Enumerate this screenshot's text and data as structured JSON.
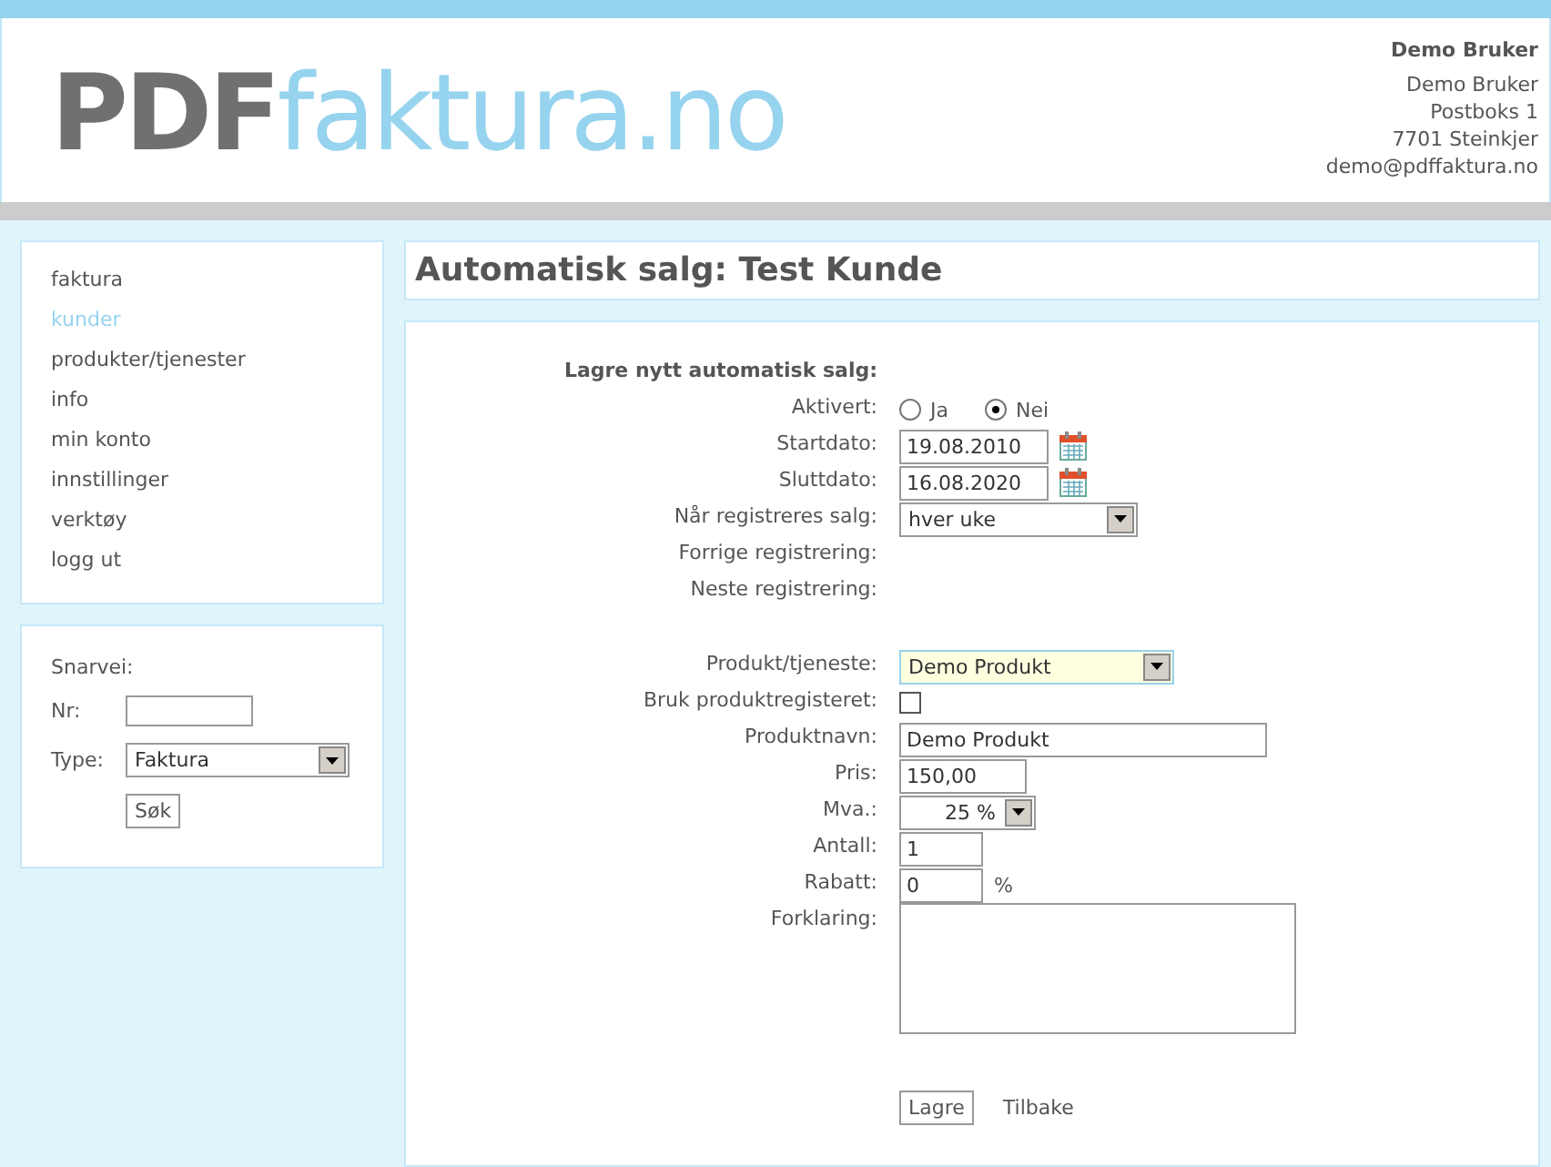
{
  "header": {
    "logo_dark": "PDF",
    "logo_light": "faktura.no",
    "user": {
      "name": "Demo Bruker",
      "lines": [
        "Demo Bruker",
        "Postboks 1",
        "7701 Steinkjer",
        "demo@pdffaktura.no"
      ]
    }
  },
  "nav": [
    {
      "label": "faktura",
      "selected": false
    },
    {
      "label": "kunder",
      "selected": true
    },
    {
      "label": "produkter/tjenester",
      "selected": false
    },
    {
      "label": "info",
      "selected": false
    },
    {
      "label": "min konto",
      "selected": false
    },
    {
      "label": "innstillinger",
      "selected": false
    },
    {
      "label": "verktøy",
      "selected": false
    },
    {
      "label": "logg ut",
      "selected": false
    }
  ],
  "shortcut": {
    "title": "Snarvei:",
    "nr_label": "Nr:",
    "type_label": "Type:",
    "type_value": "Faktura",
    "button": "Søk"
  },
  "page_title": "Automatisk salg: Test Kunde",
  "form": [
    {
      "kind": "heading",
      "label": "Lagre nytt automatisk salg:"
    },
    {
      "kind": "radio",
      "label": "Aktivert:",
      "options": [
        {
          "label": "Ja",
          "selected": false
        },
        {
          "label": "Nei",
          "selected": true
        }
      ]
    },
    {
      "kind": "date",
      "label": "Startdato:",
      "value": "19.08.2010"
    },
    {
      "kind": "date",
      "label": "Sluttdato:",
      "value": "16.08.2020"
    },
    {
      "kind": "select",
      "label": "Når registreres salg:",
      "value": "hver uke"
    },
    {
      "kind": "plain",
      "label": "Forrige registrering:"
    },
    {
      "kind": "plain",
      "label": "Neste registrering:"
    },
    {
      "kind": "spacer"
    },
    {
      "kind": "select",
      "label": "Produkt/tjeneste:",
      "value": "Demo Produkt",
      "focused": true
    },
    {
      "kind": "checkbox",
      "label": "Bruk produktregisteret:",
      "checked": false
    },
    {
      "kind": "wide_text",
      "label": "Produktnavn:",
      "value": "Demo Produkt"
    },
    {
      "kind": "text",
      "label": "Pris:",
      "value": "150,00"
    },
    {
      "kind": "vat",
      "label": "Mva.:",
      "value": "25 %"
    },
    {
      "kind": "short_text",
      "label": "Antall:",
      "value": "1"
    },
    {
      "kind": "short_text",
      "label": "Rabatt:",
      "value": "0",
      "suffix": "%"
    },
    {
      "kind": "textarea",
      "label": "Forklaring:"
    }
  ],
  "actions": {
    "save": "Lagre",
    "back": "Tilbake"
  }
}
